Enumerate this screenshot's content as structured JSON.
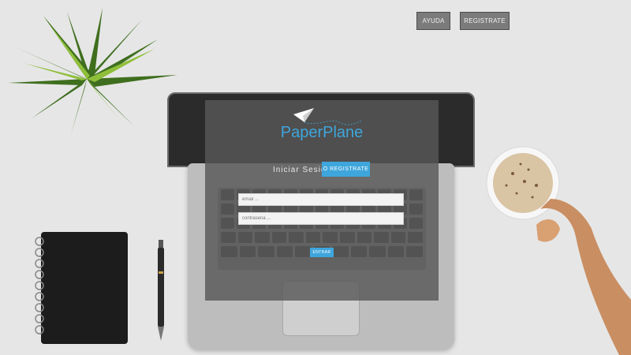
{
  "nav": {
    "help_label": "AYUDA",
    "register_label": "REGISTRATE"
  },
  "login": {
    "brand": "PaperPlane",
    "tab_login_label": "Iniciar Sesion",
    "tab_register_label": "O REGISTRATE",
    "email_placeholder": "email ...",
    "password_placeholder": "contraseña ...",
    "submit_label": "ENTRAR"
  },
  "colors": {
    "accent": "#3ea6dc",
    "nav_button_bg": "#7b7b7b"
  }
}
